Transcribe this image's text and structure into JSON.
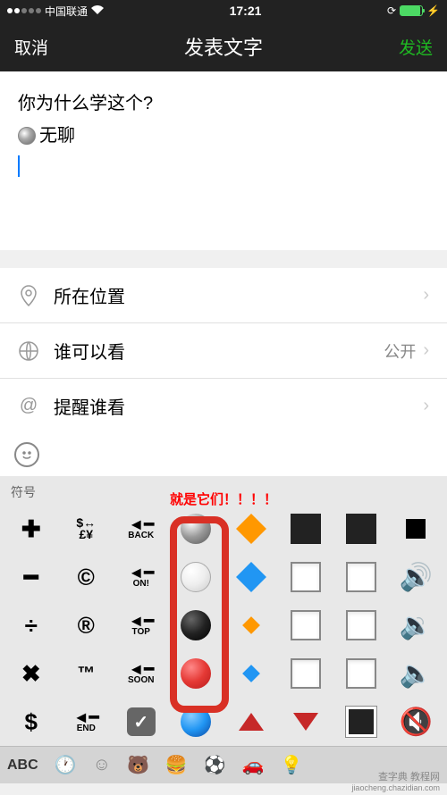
{
  "status": {
    "carrier": "中国联通",
    "time": "17:21"
  },
  "nav": {
    "cancel": "取消",
    "title": "发表文字",
    "send": "发送"
  },
  "compose": {
    "line1": "你为什么学这个?",
    "line2": "无聊"
  },
  "settings": {
    "location": {
      "label": "所在位置"
    },
    "visibility": {
      "label": "谁可以看",
      "value": "公开"
    },
    "mention": {
      "label": "提醒谁看"
    }
  },
  "annotation": "就是它们！！！！",
  "keyboard": {
    "header": "符号",
    "abc": "ABC",
    "cells": {
      "plus": "✚",
      "minus": "━",
      "divide": "÷",
      "multiply": "✖",
      "dollar": "$",
      "currency_stack_top": "$↔",
      "currency_stack_bot": "£¥",
      "copyright": "©",
      "registered": "®",
      "tm": "™",
      "back": "BACK",
      "on": "ON!",
      "top": "TOP",
      "soon": "SOON",
      "end": "END"
    }
  },
  "watermark": {
    "line1": "查字典 教程网",
    "line2": "jiaocheng.chazidian.com"
  }
}
